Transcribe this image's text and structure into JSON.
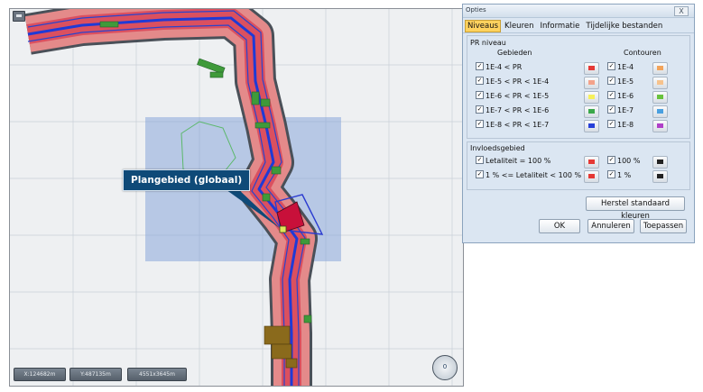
{
  "map": {
    "coords": {
      "x": "X:124682m",
      "y": "Y:487135m",
      "scale": "4551x3645m"
    },
    "callout": "Plangebied (globaal)",
    "compass": "0"
  },
  "dialog": {
    "title": "Opties",
    "close": "X",
    "tabs": [
      "Niveaus",
      "Kleuren",
      "Informatie",
      "Tijdelijke bestanden"
    ],
    "pr_section": "PR niveau",
    "col_gebieden": "Gebieden",
    "col_contouren": "Contouren",
    "pr_rows": [
      {
        "label": "1E-4 < PR",
        "area_color": "#e53935",
        "contour": "1E-4",
        "contour_color": "#f2a35a"
      },
      {
        "label": "1E-5 < PR < 1E-4",
        "area_color": "#f3a28a",
        "contour": "1E-5",
        "contour_color": "#f6c28c"
      },
      {
        "label": "1E-6 < PR < 1E-5",
        "area_color": "#f6f05a",
        "contour": "1E-6",
        "contour_color": "#68c23c"
      },
      {
        "label": "1E-7 < PR < 1E-6",
        "area_color": "#3aa84a",
        "contour": "1E-7",
        "contour_color": "#4aa0e0"
      },
      {
        "label": "1E-8 < PR < 1E-7",
        "area_color": "#2740d8",
        "contour": "1E-8",
        "contour_color": "#b040c8"
      }
    ],
    "invloed_section": "Invloedsgebied",
    "invloed_rows": [
      {
        "label": "Letaliteit = 100 %",
        "area_color": "#e53935",
        "contour": "100 %",
        "contour_color": "#222222"
      },
      {
        "label": "1 % <= Letaliteit < 100 %",
        "area_color": "#e53935",
        "contour": "1 %",
        "contour_color": "#222222"
      }
    ],
    "restore_button": "Herstel standaard kleuren",
    "ok_button": "OK",
    "cancel_button": "Annuleren",
    "apply_button": "Toepassen"
  }
}
